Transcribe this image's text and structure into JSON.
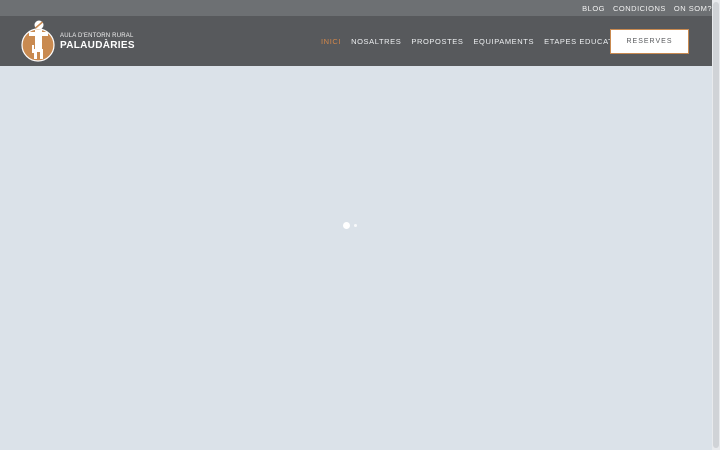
{
  "topbar": {
    "links": [
      "BLOG",
      "CONDICIONS",
      "ON SOM?"
    ]
  },
  "logo": {
    "subtitle": "AULA D'ENTORN RURAL",
    "title": "PALAUDÀRIES",
    "icon": "scarecrow-logo-icon"
  },
  "nav": {
    "items": [
      "INICI",
      "NOSALTRES",
      "PROPOSTES",
      "EQUIPAMENTS",
      "ETAPES EDUCATIVES"
    ],
    "active": "INICI"
  },
  "reserves_button": "RESERVES",
  "loader": {
    "icon": "loading-dots-icon"
  },
  "colors": {
    "topbar_bg": "#6d7073",
    "header_bg": "#57595c",
    "page_bg": "#dbe2e9",
    "accent": "#d2874a"
  }
}
